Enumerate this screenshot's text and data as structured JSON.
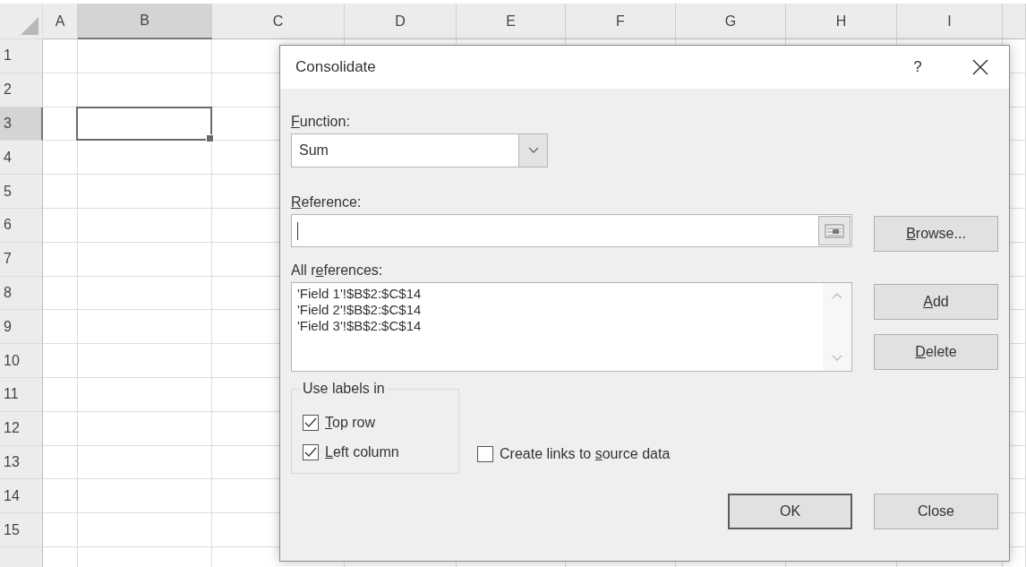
{
  "sheet": {
    "columns": [
      {
        "label": "A",
        "selected": false
      },
      {
        "label": "B",
        "selected": true
      },
      {
        "label": "C",
        "selected": false
      },
      {
        "label": "D",
        "selected": false
      },
      {
        "label": "E",
        "selected": false
      },
      {
        "label": "F",
        "selected": false
      },
      {
        "label": "G",
        "selected": false
      },
      {
        "label": "H",
        "selected": false
      },
      {
        "label": "I",
        "selected": false
      }
    ],
    "rows": [
      {
        "label": "1",
        "selected": false
      },
      {
        "label": "2",
        "selected": false
      },
      {
        "label": "3",
        "selected": true
      },
      {
        "label": "4",
        "selected": false
      },
      {
        "label": "5",
        "selected": false
      },
      {
        "label": "6",
        "selected": false
      },
      {
        "label": "7",
        "selected": false
      },
      {
        "label": "8",
        "selected": false
      },
      {
        "label": "9",
        "selected": false
      },
      {
        "label": "10",
        "selected": false
      },
      {
        "label": "11",
        "selected": false
      },
      {
        "label": "12",
        "selected": false
      },
      {
        "label": "13",
        "selected": false
      },
      {
        "label": "14",
        "selected": false
      },
      {
        "label": "15",
        "selected": false
      }
    ]
  },
  "dialog": {
    "title": "Consolidate",
    "help": "?",
    "function": {
      "label": {
        "key": "F",
        "after": "unction:"
      },
      "value": "Sum"
    },
    "reference": {
      "label": {
        "key": "R",
        "after": "eference:"
      },
      "focused": true
    },
    "all_references": {
      "label": {
        "before": "All r",
        "key": "e",
        "after": "ferences:"
      },
      "items": [
        "'Field 1'!$B$2:$C$14",
        "'Field 2'!$B$2:$C$14",
        "'Field 3'!$B$2:$C$14"
      ]
    },
    "use_labels_in": {
      "title": "Use labels in",
      "options": [
        {
          "label": {
            "key": "T",
            "after": "op row"
          },
          "checked": true
        },
        {
          "label": {
            "key": "L",
            "after": "eft column"
          },
          "checked": true
        }
      ]
    },
    "create_links": {
      "label": {
        "before": "Create links to ",
        "key": "s",
        "after": "ource data"
      },
      "checked": false
    },
    "buttons": {
      "browse": {
        "label": {
          "key": "B",
          "after": "rowse..."
        },
        "default": false
      },
      "add": {
        "label": {
          "key": "A",
          "after": "dd"
        },
        "default": false
      },
      "delete": {
        "label": {
          "key": "D",
          "after": "elete"
        },
        "default": false
      },
      "ok": {
        "label": {
          "before": "OK"
        },
        "default": true
      },
      "close": {
        "label": {
          "before": "Close"
        },
        "default": false
      }
    }
  }
}
